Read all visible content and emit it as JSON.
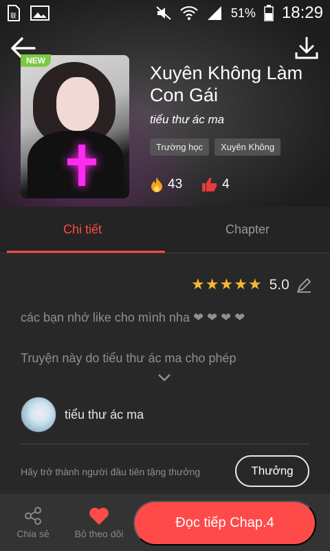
{
  "status_bar": {
    "battery_percent": "51%",
    "time": "18:29",
    "icons": [
      "sim-card-icon",
      "image-icon",
      "mute-icon",
      "wifi-icon",
      "signal-icon",
      "battery-icon"
    ]
  },
  "header": {
    "back_icon": "arrow-left-icon",
    "download_icon": "download-icon",
    "new_badge": "NEW",
    "title": "Xuyên Không Làm Con Gái",
    "author": "tiểu thư ác ma",
    "tags": [
      "Trường học",
      "Xuyên Không"
    ],
    "views": "43",
    "likes": "4"
  },
  "tabs": [
    {
      "label": "Chi tiết",
      "active": true
    },
    {
      "label": "Chapter",
      "active": false
    }
  ],
  "rating": {
    "stars": 5,
    "max_stars": 5,
    "score": "5.0"
  },
  "description": {
    "line1": "các bạn nhớ like cho mình nha ❤ ❤ ❤ ❤",
    "line2": "Truyện này do tiểu thư ác ma cho phép"
  },
  "uploader": {
    "name": "tiểu thư ác ma"
  },
  "reward": {
    "text": "Hãy trở thành người đầu tiên tặng thưởng",
    "button": "Thưởng"
  },
  "bottom_bar": {
    "share_label": "Chia sẻ",
    "follow_label": "Bỏ theo dõi",
    "read_button": "Đọc tiếp Chap.4"
  },
  "colors": {
    "accent": "#ff4a4a",
    "star": "#f7b731",
    "new_badge": "#7ac943"
  }
}
